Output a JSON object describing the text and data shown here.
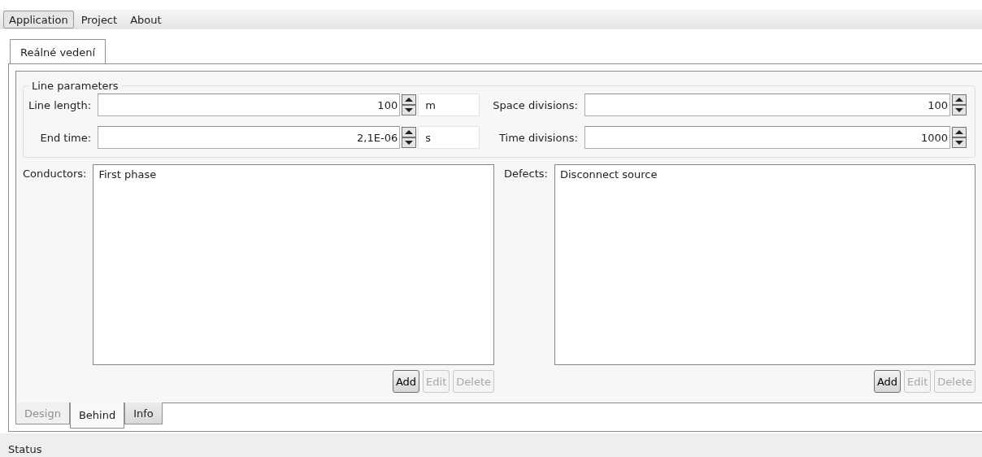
{
  "menu": [
    {
      "label": "Application",
      "selected": true
    },
    {
      "label": "Project",
      "selected": false
    },
    {
      "label": "About",
      "selected": false
    }
  ],
  "document_tabs": [
    {
      "label": "Reálné vedení",
      "selected": true
    }
  ],
  "line_parameters": {
    "title": "Line parameters",
    "left_fields": [
      {
        "label": "Line length:",
        "value": "100",
        "unit": "m"
      },
      {
        "label": "End time:",
        "value": "2,1E-06",
        "unit": "s"
      }
    ],
    "right_fields": [
      {
        "label": "Space divisions:",
        "value": "100"
      },
      {
        "label": "Time divisions:",
        "value": "1000"
      }
    ]
  },
  "lists": [
    {
      "label": "Conductors:",
      "items": [
        "First phase"
      ],
      "buttons": [
        {
          "label": "Add",
          "disabled": false
        },
        {
          "label": "Edit",
          "disabled": true
        },
        {
          "label": "Delete",
          "disabled": true
        }
      ]
    },
    {
      "label": "Defects:",
      "items": [
        "Disconnect source"
      ],
      "buttons": [
        {
          "label": "Add",
          "disabled": false
        },
        {
          "label": "Edit",
          "disabled": true
        },
        {
          "label": "Delete",
          "disabled": true
        }
      ]
    }
  ],
  "view_tabs": [
    {
      "label": "Design",
      "selected": false,
      "disabled": true
    },
    {
      "label": "Behind",
      "selected": true,
      "disabled": false
    },
    {
      "label": "Info",
      "selected": false,
      "disabled": false
    }
  ],
  "status_bar": "Status"
}
